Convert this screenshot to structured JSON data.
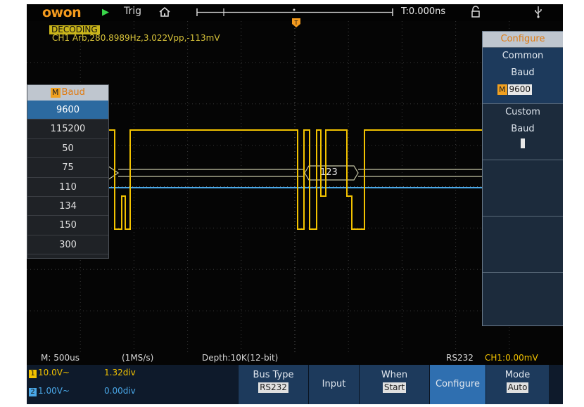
{
  "topbar": {
    "brand": "owon",
    "trig_label": "Trig",
    "time_position": "T:0.000ns",
    "icons": [
      "run-icon",
      "home-icon",
      "lock-icon",
      "usb-icon"
    ]
  },
  "status": {
    "decoding_label": "DECODING",
    "channel_info": "CH1 Arb,280.8989Hz,3.022Vpp,-113mV",
    "trigger_marker": "T"
  },
  "decode_label": "123",
  "baud_list": {
    "title_tag": "M",
    "title": "Baud",
    "items": [
      "9600",
      "115200",
      "50",
      "75",
      "110",
      "134",
      "150",
      "300"
    ],
    "selected": "9600"
  },
  "configure_panel": {
    "title": "Configure",
    "common_line1": "Common",
    "common_line2": "Baud",
    "common_tag": "M",
    "common_value": "9600",
    "custom_line1": "Custom",
    "custom_line2": "Baud"
  },
  "bottom_status": {
    "timebase": "M: 500us",
    "sample_rate": "(1MS/s)",
    "depth": "Depth:10K(12-bit)",
    "bus": "RS232",
    "trigger_level": "CH1:0.00mV"
  },
  "channels": [
    {
      "num": "1",
      "scale": "10.0V~",
      "offset": "1.32div",
      "color": "#f2c200"
    },
    {
      "num": "2",
      "scale": "1.00V~",
      "offset": "0.00div",
      "color": "#4aa8e8"
    }
  ],
  "softkeys": {
    "bus_type_label": "Bus Type",
    "bus_type_value": "RS232",
    "input_label": "Input",
    "when_label": "When",
    "when_value": "Start",
    "configure_label": "Configure",
    "mode_label": "Mode",
    "mode_value": "Auto"
  },
  "colors": {
    "ch1": "#f2c200",
    "ch2": "#4aa8e8",
    "brand": "#f39a1e",
    "selection": "#2c6aa0"
  }
}
